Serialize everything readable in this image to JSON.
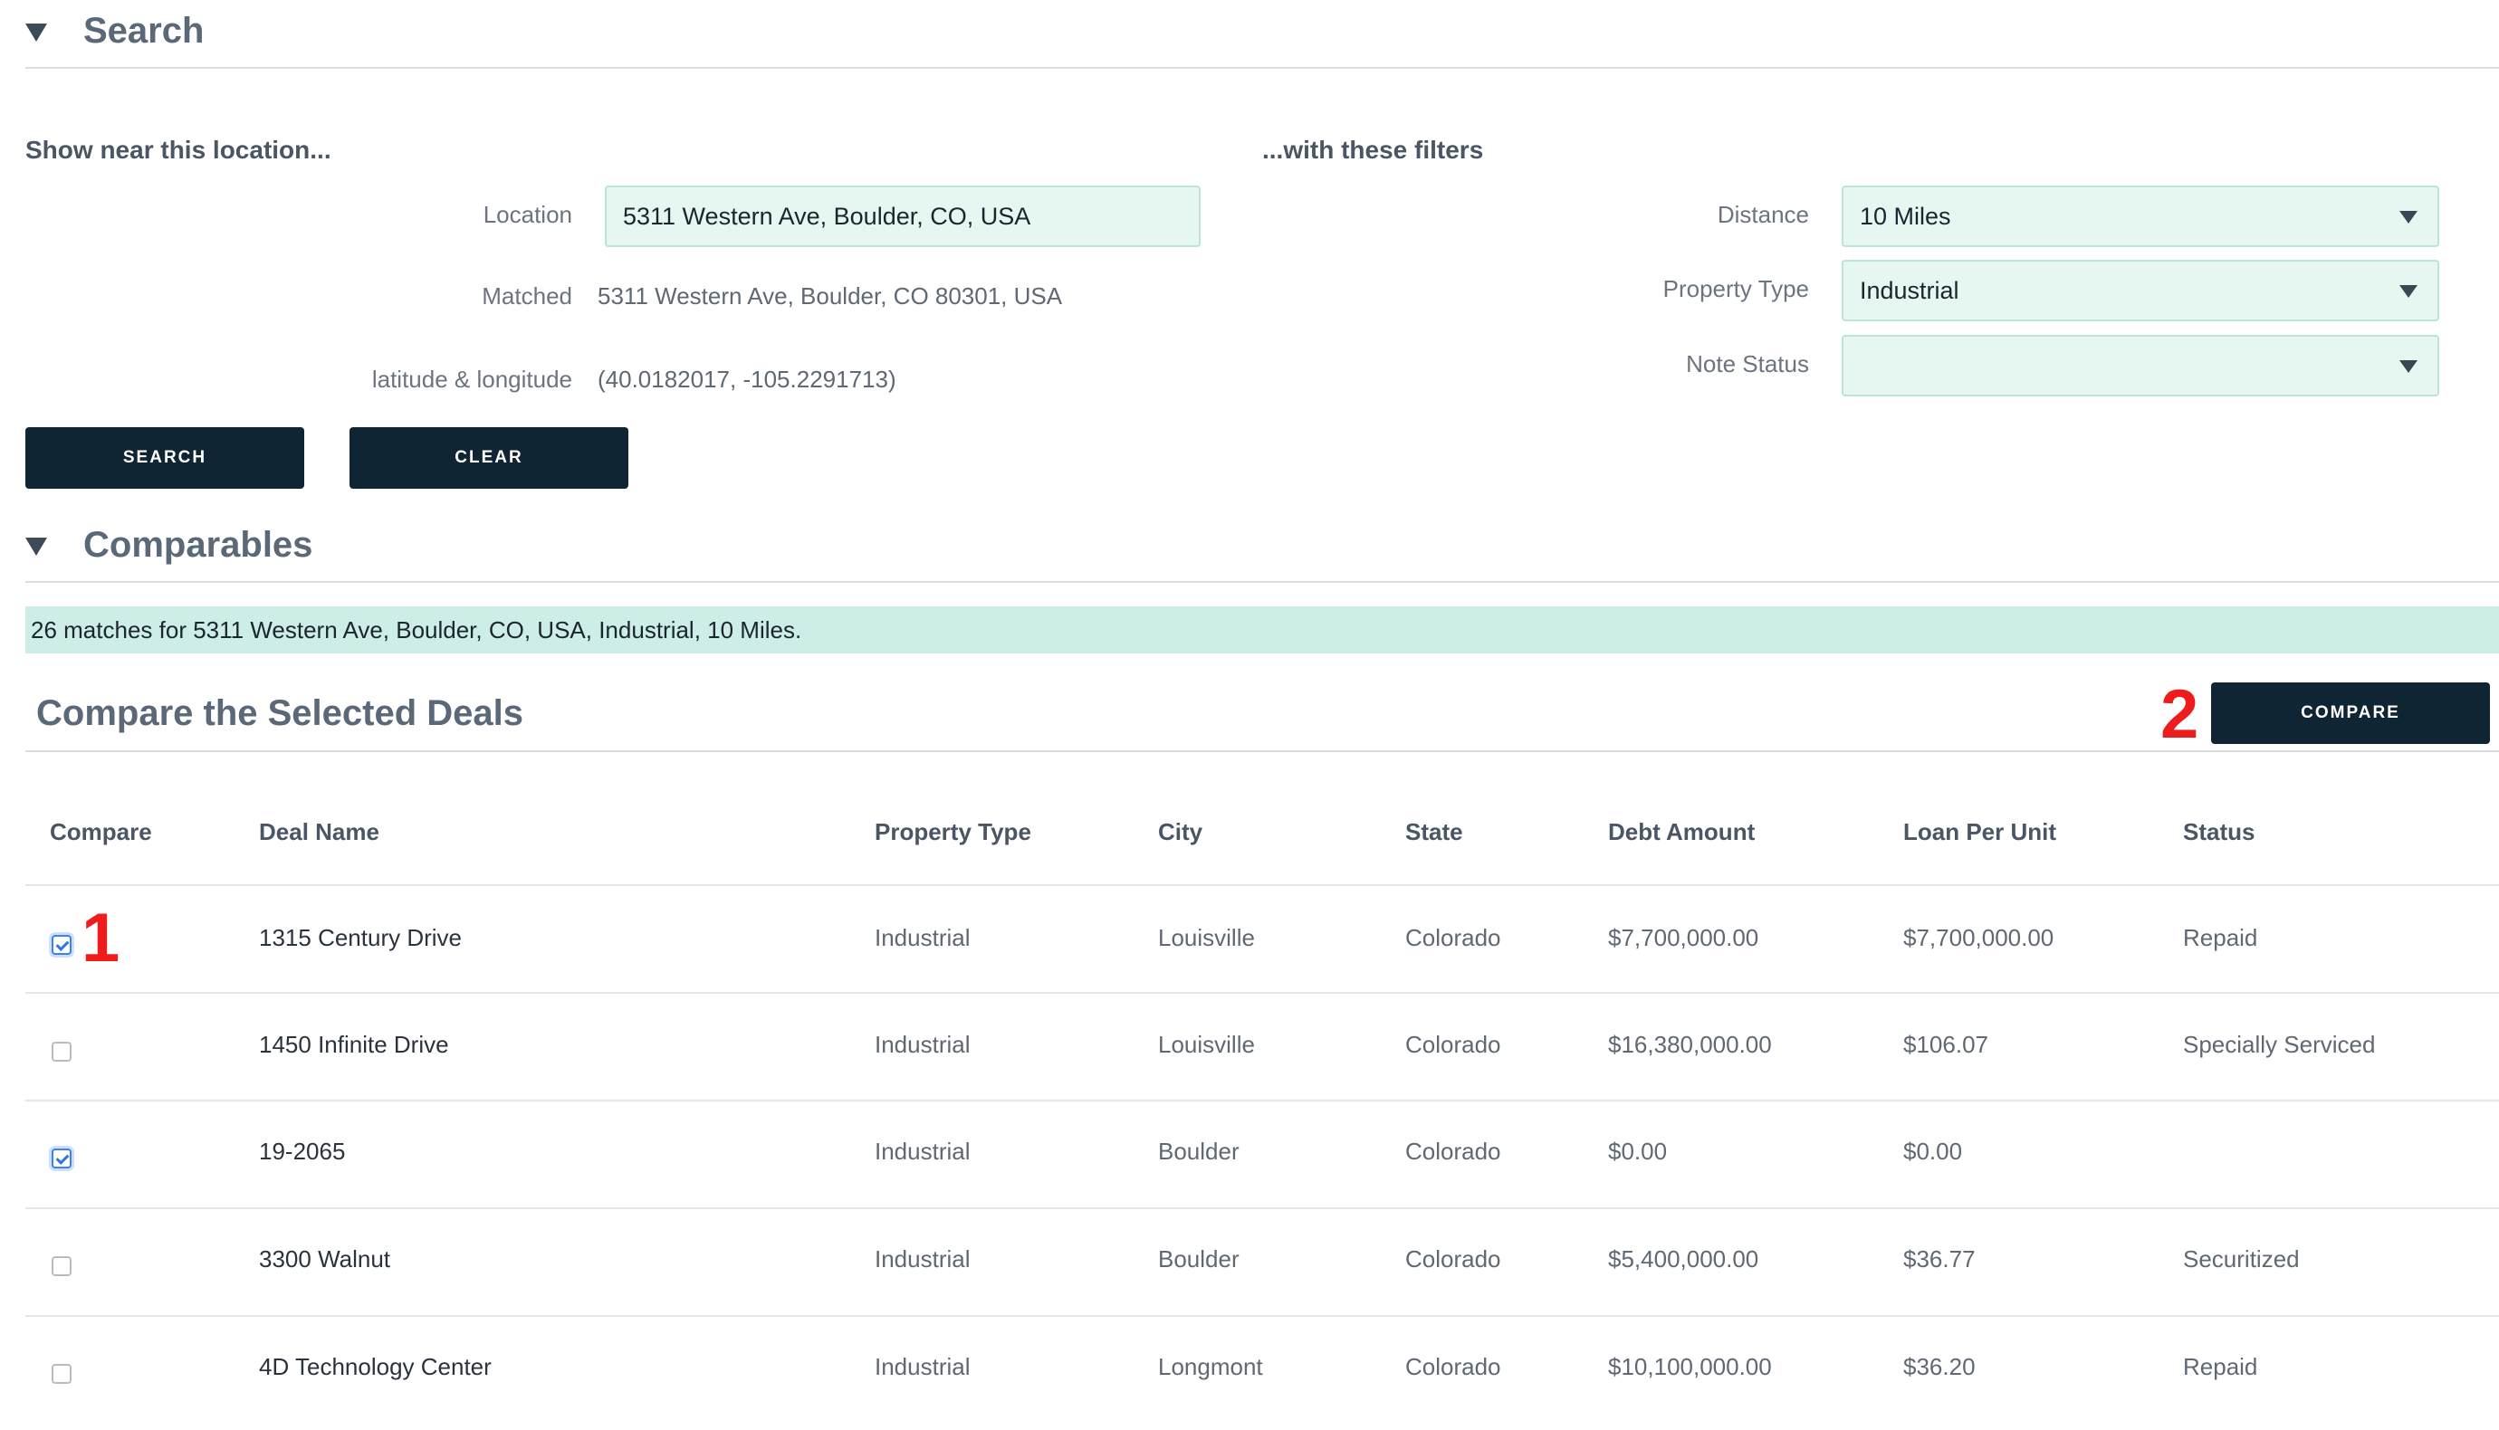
{
  "search_section": {
    "title": "Search",
    "location_heading": "Show near this location...",
    "filters_heading": "...with these filters",
    "location_label": "Location",
    "location_value": "5311 Western Ave, Boulder, CO, USA",
    "matched_label": "Matched",
    "matched_value": "5311 Western Ave, Boulder, CO 80301, USA",
    "latlng_label": "latitude & longitude",
    "latlng_value": "(40.0182017, -105.2291713)",
    "distance_label": "Distance",
    "distance_value": "10 Miles",
    "property_type_label": "Property Type",
    "property_type_value": "Industrial",
    "note_status_label": "Note Status",
    "note_status_value": "",
    "search_button": "SEARCH",
    "clear_button": "CLEAR"
  },
  "comparables_section": {
    "title": "Comparables",
    "banner": "26 matches for 5311 Western Ave, Boulder, CO, USA, Industrial, 10 Miles.",
    "compare_title": "Compare the Selected Deals",
    "compare_button": "COMPARE",
    "annotation_1": "1",
    "annotation_2": "2"
  },
  "table": {
    "headers": [
      "Compare",
      "Deal Name",
      "Property Type",
      "City",
      "State",
      "Debt Amount",
      "Loan Per Unit",
      "Status"
    ],
    "rows": [
      {
        "checked": true,
        "deal": "1315 Century Drive",
        "type": "Industrial",
        "city": "Louisville",
        "state": "Colorado",
        "debt": "$7,700,000.00",
        "per_unit": "$7,700,000.00",
        "status": "Repaid"
      },
      {
        "checked": false,
        "deal": "1450 Infinite Drive",
        "type": "Industrial",
        "city": "Louisville",
        "state": "Colorado",
        "debt": "$16,380,000.00",
        "per_unit": "$106.07",
        "status": "Specially Serviced"
      },
      {
        "checked": true,
        "deal": "19-2065",
        "type": "Industrial",
        "city": "Boulder",
        "state": "Colorado",
        "debt": "$0.00",
        "per_unit": "$0.00",
        "status": ""
      },
      {
        "checked": false,
        "deal": "3300 Walnut",
        "type": "Industrial",
        "city": "Boulder",
        "state": "Colorado",
        "debt": "$5,400,000.00",
        "per_unit": "$36.77",
        "status": "Securitized"
      },
      {
        "checked": false,
        "deal": "4D Technology Center",
        "type": "Industrial",
        "city": "Longmont",
        "state": "Colorado",
        "debt": "$10,100,000.00",
        "per_unit": "$36.20",
        "status": "Repaid"
      }
    ]
  }
}
